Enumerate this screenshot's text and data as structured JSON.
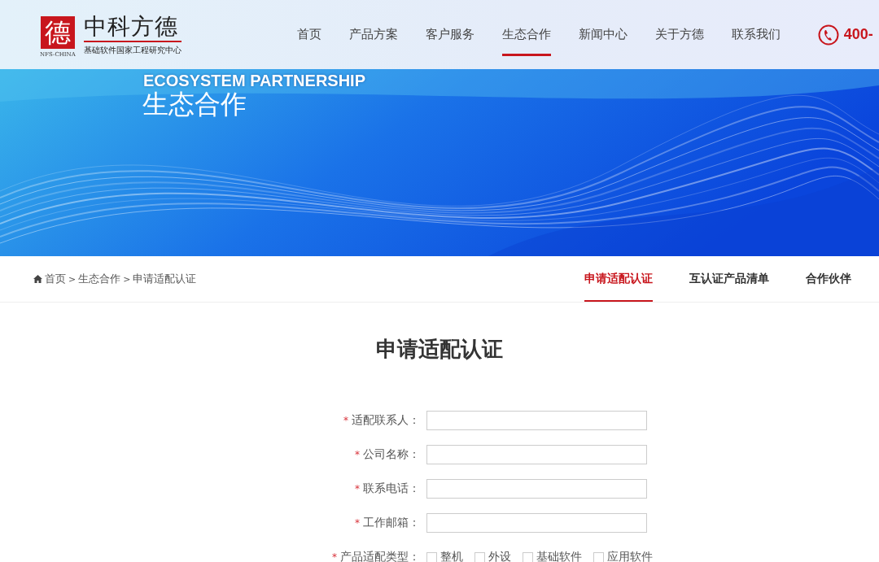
{
  "logo": {
    "mark": "德",
    "brand": "中科方德",
    "latin": "NFS-CHINA",
    "subtitle": "基础软件国家工程研究中心"
  },
  "nav": [
    {
      "label": "首页",
      "selected": false
    },
    {
      "label": "产品方案",
      "selected": false
    },
    {
      "label": "客户服务",
      "selected": false
    },
    {
      "label": "生态合作",
      "selected": true
    },
    {
      "label": "新闻中心",
      "selected": false
    },
    {
      "label": "关于方德",
      "selected": false
    },
    {
      "label": "联系我们",
      "selected": false
    }
  ],
  "phone": "400-",
  "banner": {
    "subtitle": "ECOSYSTEM PARTNERSHIP",
    "title": "生态合作"
  },
  "breadcrumb": [
    {
      "label": "首页"
    },
    {
      "separator": ">",
      "label": "生态合作"
    },
    {
      "separator": ">",
      "label": "申请适配认证"
    }
  ],
  "tabs": [
    {
      "label": "申请适配认证",
      "selected": true
    },
    {
      "label": "互认证产品清单",
      "selected": false
    },
    {
      "label": "合作伙伴",
      "selected": false
    }
  ],
  "form": {
    "title": "申请适配认证",
    "fields": [
      {
        "kind": "text",
        "label": "适配联系人：",
        "required_mark": "*"
      },
      {
        "kind": "text",
        "label": "公司名称：",
        "required_mark": "*"
      },
      {
        "kind": "text",
        "label": "联系电话：",
        "required_mark": "*"
      },
      {
        "kind": "text",
        "label": "工作邮箱：",
        "required_mark": "*"
      },
      {
        "kind": "checkboxes",
        "label": "产品适配类型：",
        "required_mark": "*",
        "options": [
          {
            "label": "整机",
            "checked": false
          },
          {
            "label": "外设",
            "checked": false
          },
          {
            "label": "基础软件",
            "checked": false
          },
          {
            "label": "应用软件",
            "checked": false
          }
        ]
      }
    ]
  }
}
